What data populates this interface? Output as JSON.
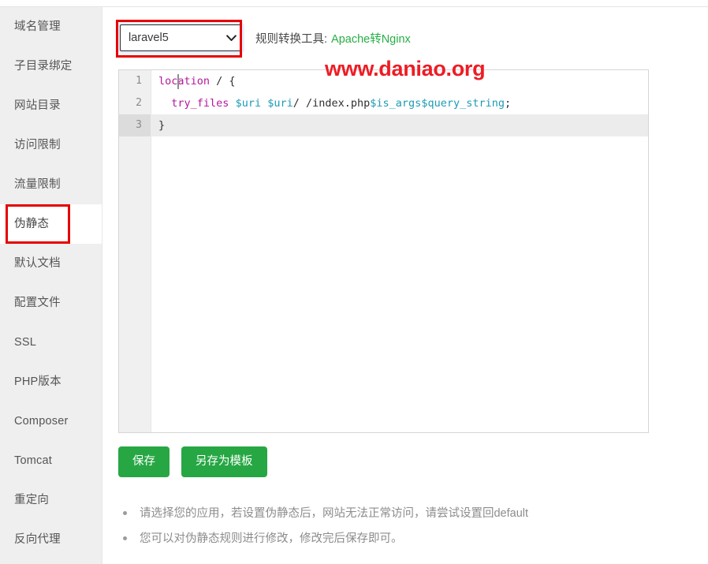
{
  "sidebar": {
    "items": [
      {
        "label": "域名管理",
        "active": false
      },
      {
        "label": "子目录绑定",
        "active": false
      },
      {
        "label": "网站目录",
        "active": false
      },
      {
        "label": "访问限制",
        "active": false
      },
      {
        "label": "流量限制",
        "active": false
      },
      {
        "label": "伪静态",
        "active": true
      },
      {
        "label": "默认文档",
        "active": false
      },
      {
        "label": "配置文件",
        "active": false
      },
      {
        "label": "SSL",
        "active": false
      },
      {
        "label": "PHP版本",
        "active": false
      },
      {
        "label": "Composer",
        "active": false
      },
      {
        "label": "Tomcat",
        "active": false
      },
      {
        "label": "重定向",
        "active": false
      },
      {
        "label": "反向代理",
        "active": false
      }
    ]
  },
  "toolbar": {
    "select_value": "laravel5",
    "select_arrow_icon": "chevron-down-icon",
    "converter_label": "规则转换工具:",
    "converter_link": "Apache转Nginx"
  },
  "watermark": {
    "text": "www.daniao.org",
    "color": "#ee1c24"
  },
  "editor": {
    "lines": [
      {
        "number": "1",
        "active": false,
        "tokens": [
          {
            "t": "location",
            "c": "tok-kw"
          },
          {
            "t": " / {",
            "c": "tok-txt"
          }
        ]
      },
      {
        "number": "2",
        "active": false,
        "tokens": [
          {
            "t": "  ",
            "c": "tok-txt"
          },
          {
            "t": "try_files",
            "c": "tok-kw"
          },
          {
            "t": " ",
            "c": "tok-txt"
          },
          {
            "t": "$uri",
            "c": "tok-var"
          },
          {
            "t": " ",
            "c": "tok-txt"
          },
          {
            "t": "$uri",
            "c": "tok-var"
          },
          {
            "t": "/ /index.php",
            "c": "tok-txt"
          },
          {
            "t": "$is_args",
            "c": "tok-var"
          },
          {
            "t": "$query_string",
            "c": "tok-var"
          },
          {
            "t": ";",
            "c": "tok-txt"
          }
        ]
      },
      {
        "number": "3",
        "active": true,
        "tokens": [
          {
            "t": "}",
            "c": "tok-txt"
          }
        ]
      }
    ],
    "plain_text": "location / {\n  try_files $uri $uri/ /index.php$is_args$query_string;\n}"
  },
  "buttons": {
    "save": "保存",
    "save_as_template": "另存为模板"
  },
  "help": {
    "items": [
      "请选择您的应用，若设置伪静态后，网站无法正常访问，请尝试设置回default",
      "您可以对伪静态规则进行修改，修改完后保存即可。"
    ]
  },
  "annotations": {
    "sidebar_highlight": "伪静态",
    "select_highlight": "laravel5"
  },
  "colors": {
    "accent_green": "#27a744",
    "link_green": "#27ae45",
    "annotation_red": "#e60000",
    "sidebar_bg": "#efefef"
  }
}
